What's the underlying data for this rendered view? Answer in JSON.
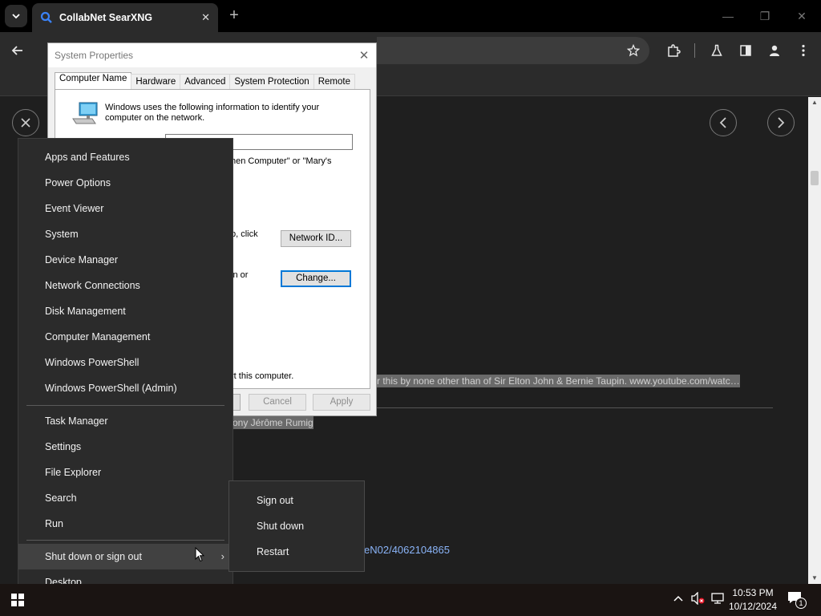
{
  "browser": {
    "tab_title": "CollabNet SearXNG",
    "tab_close": "✕",
    "new_tab": "+"
  },
  "page": {
    "highlight_line1": "r this by none other than of Sir Elton John & Bernie Taupin. www.youtube.com/watc…",
    "highlight_line2": "ony Jérôme Rumig",
    "link_text": "eN02/4062104865"
  },
  "dialog": {
    "title": "System Properties",
    "tabs": [
      "Computer Name",
      "Hardware",
      "Advanced",
      "System Protection",
      "Remote"
    ],
    "intro": "Windows uses the following information to identify your computer on the network.",
    "partial_text_1": "hen Computer\" or \"Mary's",
    "partial_text_2": "p, click",
    "partial_text_3": "in or",
    "partial_text_4": "rt this computer.",
    "network_id_button": "Network ID...",
    "change_button": "Change...",
    "cancel_button": "Cancel",
    "apply_button": "Apply"
  },
  "context_menu": {
    "items_group1": [
      "Apps and Features",
      "Power Options",
      "Event Viewer",
      "System",
      "Device Manager",
      "Network Connections",
      "Disk Management",
      "Computer Management",
      "Windows PowerShell",
      "Windows PowerShell (Admin)"
    ],
    "items_group2": [
      "Task Manager",
      "Settings",
      "File Explorer",
      "Search",
      "Run"
    ],
    "shutdown_item": "Shut down or sign out",
    "desktop_item": "Desktop"
  },
  "submenu": {
    "items": [
      "Sign out",
      "Shut down",
      "Restart"
    ]
  },
  "taskbar": {
    "time": "10:53 PM",
    "date": "10/12/2024",
    "notification_count": "1"
  }
}
